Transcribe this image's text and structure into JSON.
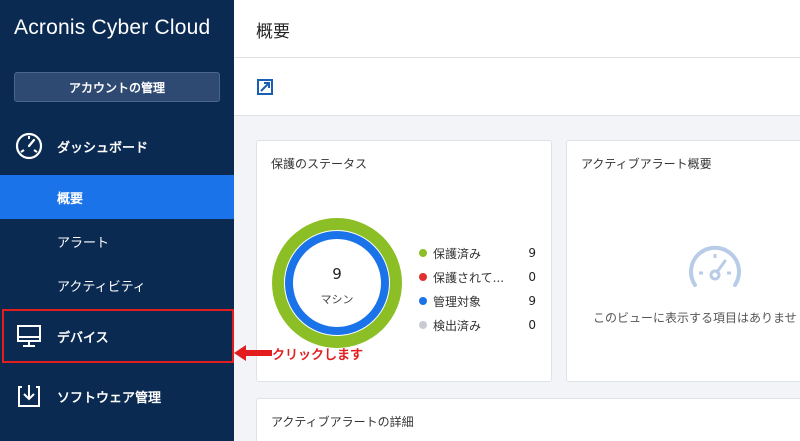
{
  "sidebar": {
    "brand": "Acronis Cyber Cloud",
    "account_button": "アカウントの管理",
    "dashboard": {
      "label": "ダッシュボード",
      "icon": "dashboard-gauge-icon"
    },
    "sub_items": [
      {
        "label": "概要",
        "active": true
      },
      {
        "label": "アラート",
        "active": false
      },
      {
        "label": "アクティビティ",
        "active": false
      }
    ],
    "devices": {
      "label": "デバイス",
      "icon": "monitor-icon"
    },
    "software": {
      "label": "ソフトウェア管理",
      "icon": "download-box-icon"
    }
  },
  "annotation": {
    "label": "クリックします",
    "color": "#e31d1d"
  },
  "header": {
    "title": "概要"
  },
  "cards": {
    "protection": {
      "title": "保護のステータス",
      "total": "9",
      "unit": "マシン",
      "legend": [
        {
          "label": "保護済み",
          "value": "9",
          "color": "#8cbf26"
        },
        {
          "label": "保護されて...",
          "value": "0",
          "color": "#e0312f"
        },
        {
          "label": "管理対象",
          "value": "9",
          "color": "#1a73e8"
        },
        {
          "label": "検出済み",
          "value": "0",
          "color": "#c8ccd2"
        }
      ]
    },
    "alerts_overview": {
      "title": "アクティブアラート概要",
      "empty_text": "このビューに表示する項目はありませ"
    },
    "alerts_detail": {
      "title": "アクティブアラートの詳細"
    }
  },
  "colors": {
    "sidebar_bg": "#0a2a52",
    "active_bg": "#1a73e8",
    "protected_ring": "#8cbf26",
    "managed_ring": "#1a73e8"
  }
}
